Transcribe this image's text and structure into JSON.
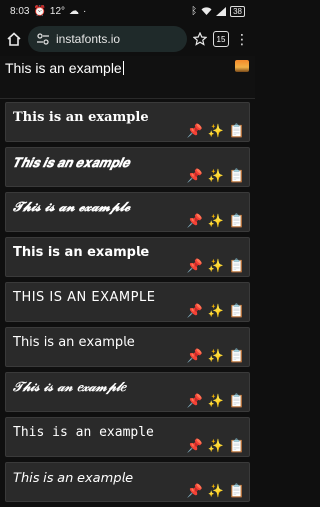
{
  "status": {
    "time": "8:03",
    "weather": "12°",
    "battery": "38"
  },
  "browser": {
    "url": "instafonts.io",
    "tab_count": "15"
  },
  "input": {
    "value": "This is an example"
  },
  "fonts": [
    {
      "text": "𝐓𝐡𝐢𝐬 𝐢𝐬 𝐚𝐧 𝐞𝐱𝐚𝐦𝐩𝐥𝐞"
    },
    {
      "text": "𝑻𝒉𝒊𝒔 𝒊𝒔 𝒂𝒏 𝒆𝒙𝒂𝒎𝒑𝒍𝒆"
    },
    {
      "text": "𝓣𝓱𝓲𝓼 𝓲𝓼 𝓪𝓷 𝓮𝔁𝓪𝓶𝓹𝓵𝓮"
    },
    {
      "text": "𝗧𝗵𝗶𝘀 𝗶𝘀 𝗮𝗻 𝗲𝘅𝗮𝗺𝗽𝗹𝗲"
    },
    {
      "text": "THIS IS AN EXAMPLE"
    },
    {
      "text": "𝖳𝗁𝗂𝗌 𝗂𝗌 𝖺𝗇 𝖾𝗑𝖺𝗆𝗉𝗅𝖾"
    },
    {
      "text": "𝒯𝒽𝒾𝓈 𝒾𝓈 𝒶𝓃 𝑒𝓍𝒶𝓂𝓅𝓁𝑒"
    },
    {
      "text": "𝚃𝚑𝚒𝚜 𝚒𝚜 𝚊𝚗 𝚎𝚡𝚊𝚖𝚙𝚕𝚎"
    },
    {
      "text": "𝘛𝘩𝘪𝘴 𝘪𝘴 𝘢𝘯 𝘦𝘹𝘢𝘮𝘱𝘭𝘦"
    }
  ],
  "icons": {
    "pin": "📌",
    "sparkles": "✨",
    "clipboard": "📋"
  }
}
